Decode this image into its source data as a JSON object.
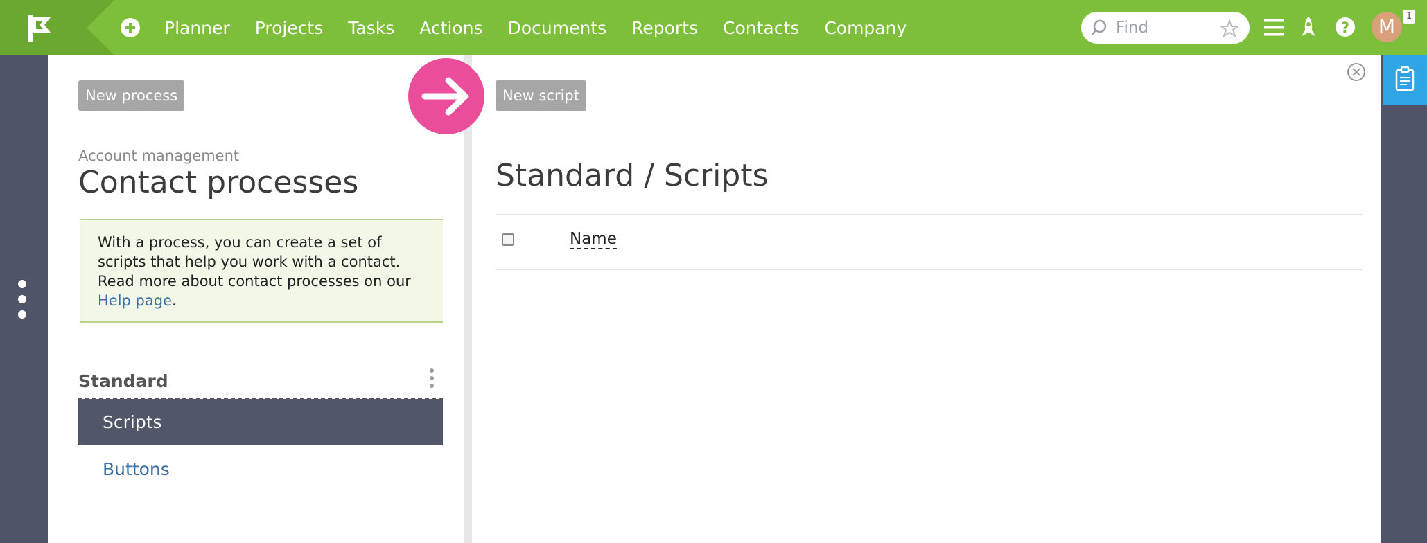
{
  "topbar": {
    "nav": [
      "Planner",
      "Projects",
      "Tasks",
      "Actions",
      "Documents",
      "Reports",
      "Contacts",
      "Company"
    ],
    "search_placeholder": "Find",
    "avatar_letter": "M",
    "notification_count": "1",
    "icons": [
      "flag-logo-icon",
      "add-icon",
      "search-icon",
      "star-icon",
      "menu-icon",
      "rocket-icon",
      "help-icon",
      "clipboard-icon"
    ],
    "accent_color": "#7dbf3b"
  },
  "left": {
    "new_button": "New process",
    "breadcrumb": "Account management",
    "title": "Contact processes",
    "info_text": "With a process, you can create a set of scripts that help you work with a contact. Read more about contact processes on our ",
    "info_link": "Help page",
    "info_end": ".",
    "section": "Standard",
    "items": [
      {
        "label": "Scripts",
        "active": true
      },
      {
        "label": "Buttons",
        "active": false
      }
    ]
  },
  "right": {
    "new_button": "New script",
    "title": "Standard / Scripts",
    "column_name": "Name"
  },
  "colors": {
    "active_item": "#515769",
    "arrow_badge": "#ea4d99",
    "link": "#3a6ea5",
    "clipboard_tab": "#2fa5e6"
  }
}
